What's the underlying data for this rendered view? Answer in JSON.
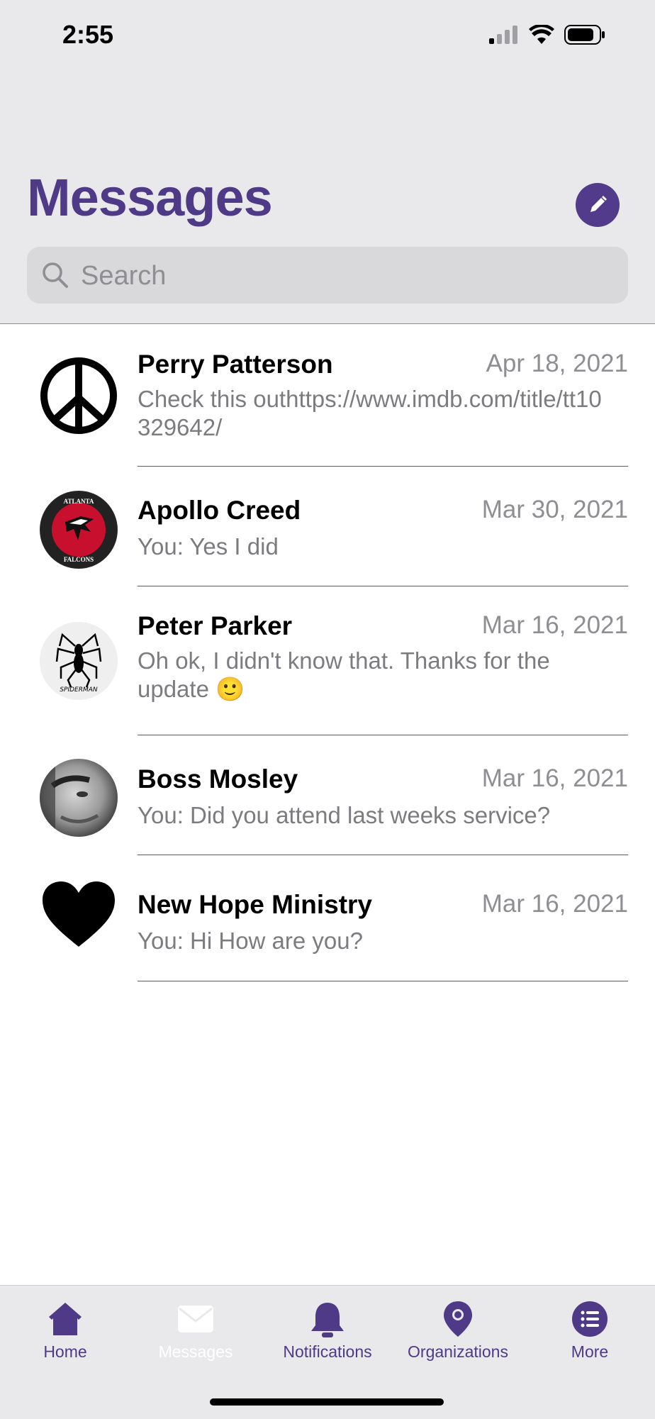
{
  "status_bar": {
    "time": "2:55"
  },
  "header": {
    "title": "Messages",
    "search_placeholder": "Search",
    "compose_icon": "pencil-icon"
  },
  "colors": {
    "accent": "#4e3a86",
    "secondary_text": "#8e8e93",
    "header_bg": "#e9e8ea"
  },
  "conversations": [
    {
      "name": "Perry Patterson",
      "date": "Apr 18, 2021",
      "preview": "Check this outhttps://www.imdb.com/title/tt10329642/",
      "avatar": "peace-sign-icon"
    },
    {
      "name": "Apollo Creed",
      "date": "Mar 30, 2021",
      "preview": "You:  Yes I did",
      "avatar": "falcons-logo",
      "avatar_text": "ATLANTA FALCONS"
    },
    {
      "name": "Peter Parker",
      "date": "Mar 16, 2021",
      "preview": "Oh ok, I didn't know that. Thanks for the update 🙂",
      "avatar": "spider-logo",
      "avatar_text": "SPIDERMAN"
    },
    {
      "name": "Boss Mosley",
      "date": "Mar 16, 2021",
      "preview": "You:  Did you attend last weeks service?",
      "avatar": "user-photo"
    },
    {
      "name": "New Hope Ministry",
      "date": "Mar 16, 2021",
      "preview": "You:  Hi How are you?",
      "avatar": "heart-icon"
    }
  ],
  "tabs": [
    {
      "label": "Home",
      "icon": "home-icon",
      "active": false
    },
    {
      "label": "Messages",
      "icon": "envelope-icon",
      "active": true
    },
    {
      "label": "Notifications",
      "icon": "bell-icon",
      "active": false
    },
    {
      "label": "Organizations",
      "icon": "map-pin-icon",
      "active": false
    },
    {
      "label": "More",
      "icon": "list-icon",
      "active": false
    }
  ]
}
